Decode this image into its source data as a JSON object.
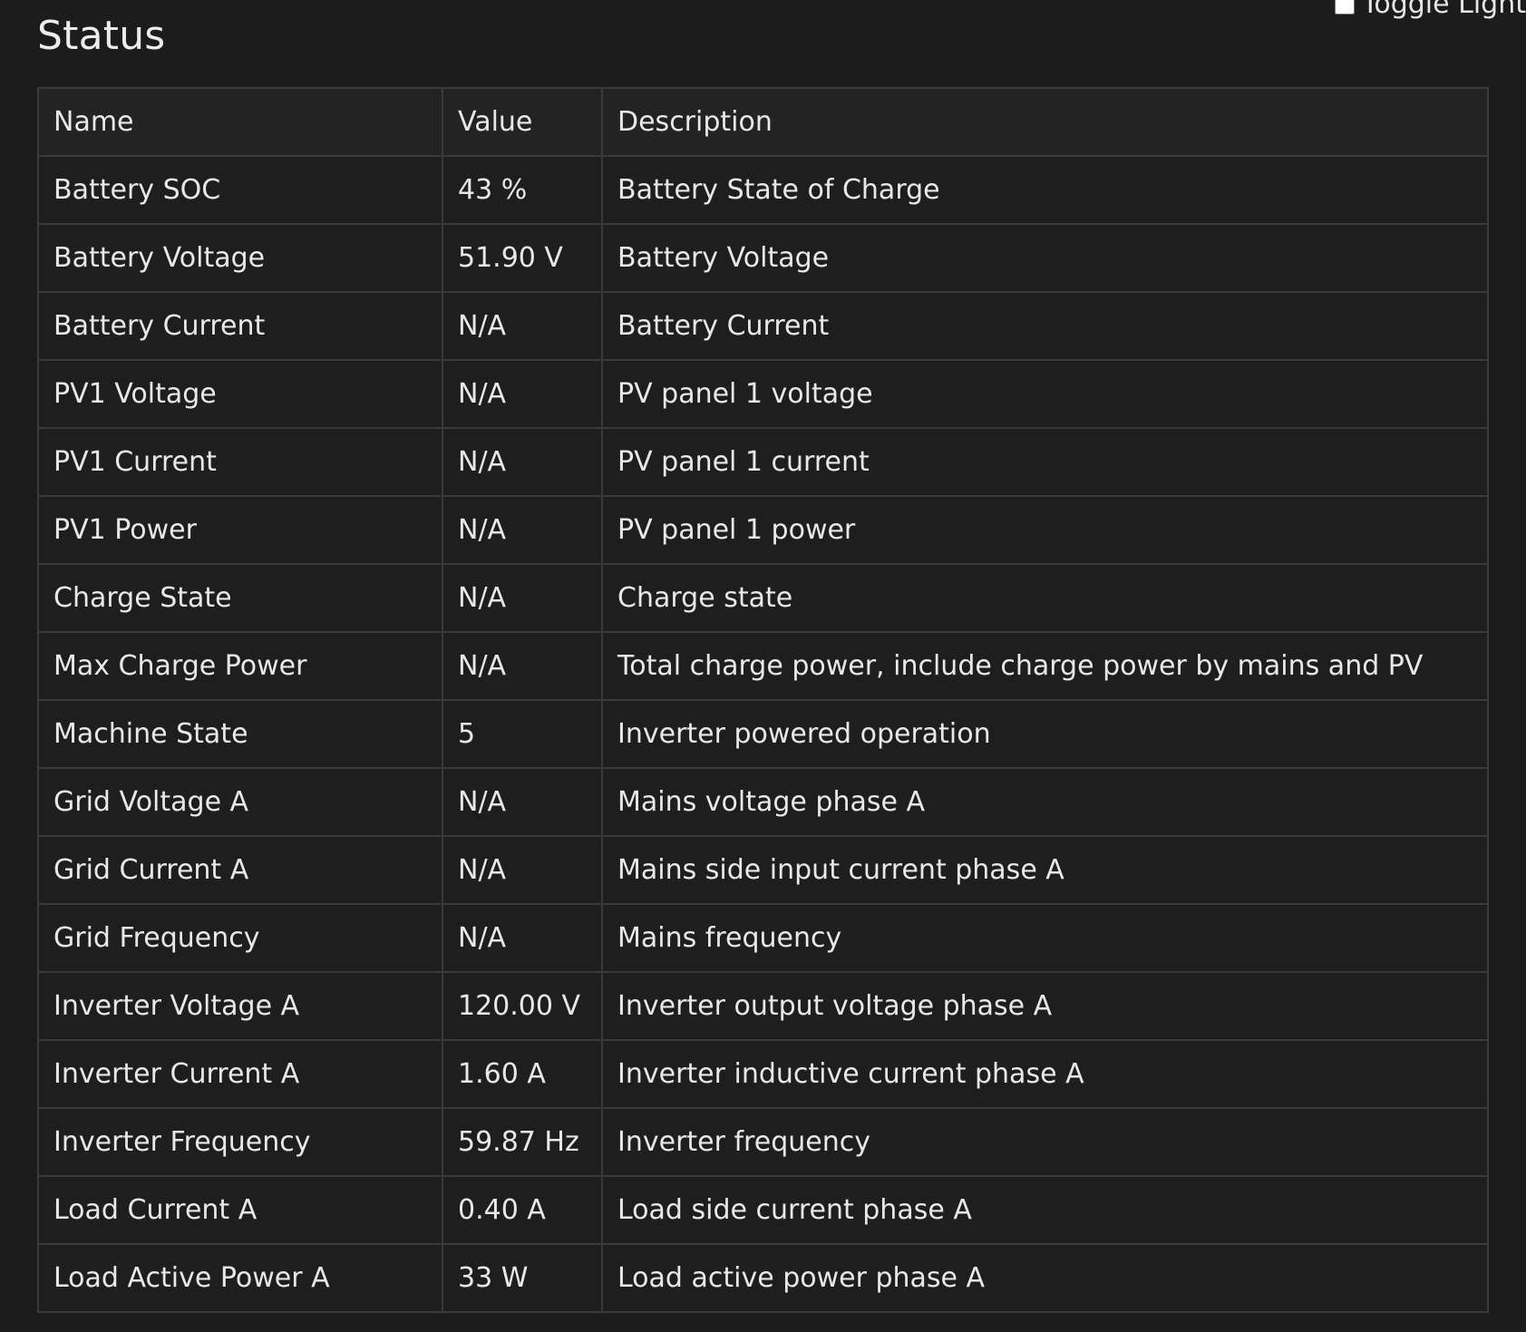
{
  "toggle": {
    "label": "Toggle Light"
  },
  "page_title": "Status",
  "table": {
    "headers": [
      "Name",
      "Value",
      "Description"
    ],
    "rows": [
      [
        "Battery SOC",
        "43 %",
        "Battery State of Charge"
      ],
      [
        "Battery Voltage",
        "51.90 V",
        "Battery Voltage"
      ],
      [
        "Battery Current",
        "N/A",
        "Battery Current"
      ],
      [
        "PV1 Voltage",
        "N/A",
        "PV panel 1 voltage"
      ],
      [
        "PV1 Current",
        "N/A",
        "PV panel 1 current"
      ],
      [
        "PV1 Power",
        "N/A",
        "PV panel 1 power"
      ],
      [
        "Charge State",
        "N/A",
        "Charge state"
      ],
      [
        "Max Charge Power",
        "N/A",
        "Total charge power, include charge power by mains and PV"
      ],
      [
        "Machine State",
        "5",
        "Inverter powered operation"
      ],
      [
        "Grid Voltage A",
        "N/A",
        "Mains voltage phase A"
      ],
      [
        "Grid Current A",
        "N/A",
        "Mains side input current phase A"
      ],
      [
        "Grid Frequency",
        "N/A",
        "Mains frequency"
      ],
      [
        "Inverter Voltage A",
        "120.00 V",
        "Inverter output voltage phase A"
      ],
      [
        "Inverter Current A",
        "1.60 A",
        "Inverter inductive current phase A"
      ],
      [
        "Inverter Frequency",
        "59.87 Hz",
        "Inverter frequency"
      ],
      [
        "Load Current A",
        "0.40 A",
        "Load side current phase A"
      ],
      [
        "Load Active Power A",
        "33 W",
        "Load active power phase A"
      ]
    ]
  }
}
